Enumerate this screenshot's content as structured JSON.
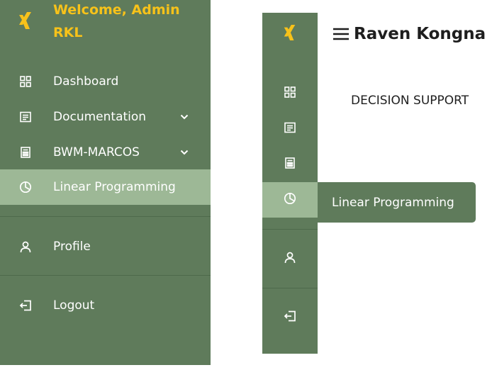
{
  "brand": {
    "welcome_text": "Welcome, Admin RKL",
    "logo_icon": "xing-logo-icon",
    "accent_color": "#f7c21a"
  },
  "sidebar": {
    "background": "#5f7b5b",
    "active_background": "#9db896",
    "items": [
      {
        "label": "Dashboard",
        "icon": "dashboard-grid-icon"
      },
      {
        "label": "Documentation",
        "icon": "document-icon",
        "expandable": true
      },
      {
        "label": "BWM-MARCOS",
        "icon": "calculator-icon",
        "expandable": true
      },
      {
        "label": "Linear Programming",
        "icon": "pie-chart-icon",
        "active": true
      },
      {
        "label": "Profile",
        "icon": "user-icon"
      },
      {
        "label": "Logout",
        "icon": "logout-icon"
      }
    ]
  },
  "tooltip": {
    "label": "Linear Programming"
  },
  "header": {
    "title": "Raven Kongna",
    "section_title": "DECISION SUPPORT"
  }
}
